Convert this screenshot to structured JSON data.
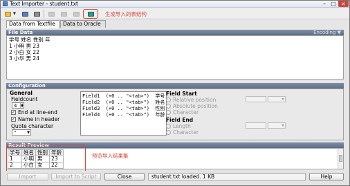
{
  "window": {
    "title": "Text Importer - student.txt"
  },
  "toolbar": {
    "icons": [
      "open-table-icon",
      "copy-icon",
      "settings-icon",
      "save-icon-disabled",
      "save-as-icon-disabled",
      "export-icon-disabled",
      "generate-table-icon"
    ],
    "annotation": "生成导入的表结构"
  },
  "tabs": [
    {
      "label": "Data from Textfile"
    },
    {
      "label": "Data to Oracle"
    }
  ],
  "file_data": {
    "header": "File Data",
    "encoding_label": "Encoding",
    "lines": [
      "学号 姓名 性别 年",
      "1 小明 男 23",
      "2 小白 女 22",
      "3 小华 男 24"
    ]
  },
  "configuration": {
    "header": "Configuration",
    "general": {
      "title": "General",
      "fieldcount_label": "Fieldcount",
      "fieldcount_value": "4",
      "end_at_line_end": "End at line-end",
      "name_in_header": "Name in header",
      "quote_label": "Quote character",
      "quote_value": "\""
    },
    "fields": [
      "Field1  (+0 .. \"<tab>\")  学号",
      "Field2  (+0 .. \"<tab>\")  姓名",
      "Field3  (+0 .. \"<tab>\")  性别",
      "Field4  (+0 .. \"<tab>\")  年龄"
    ],
    "field_start": {
      "title": "Field Start",
      "options": [
        "Relative position",
        "Absolute position",
        "Character"
      ]
    },
    "field_end": {
      "title": "Field End",
      "options": [
        "Length",
        "Character"
      ]
    }
  },
  "result_preview": {
    "header": "Result Preview",
    "columns": [
      "学号",
      "姓名",
      "性别",
      "年龄"
    ],
    "rows": [
      [
        "1",
        "小明",
        "男",
        "23"
      ],
      [
        "2",
        "小白",
        "女",
        "22"
      ]
    ],
    "annotation": "预览导入结果集"
  },
  "buttons": {
    "import": "Import",
    "import_to_script": "Import to Script",
    "close": "Close",
    "help": "Help"
  },
  "status": "student.txt loaded.   1 KB",
  "colors": {
    "annotation_red": "#d9463a",
    "section_bar": "#6b7b93"
  }
}
